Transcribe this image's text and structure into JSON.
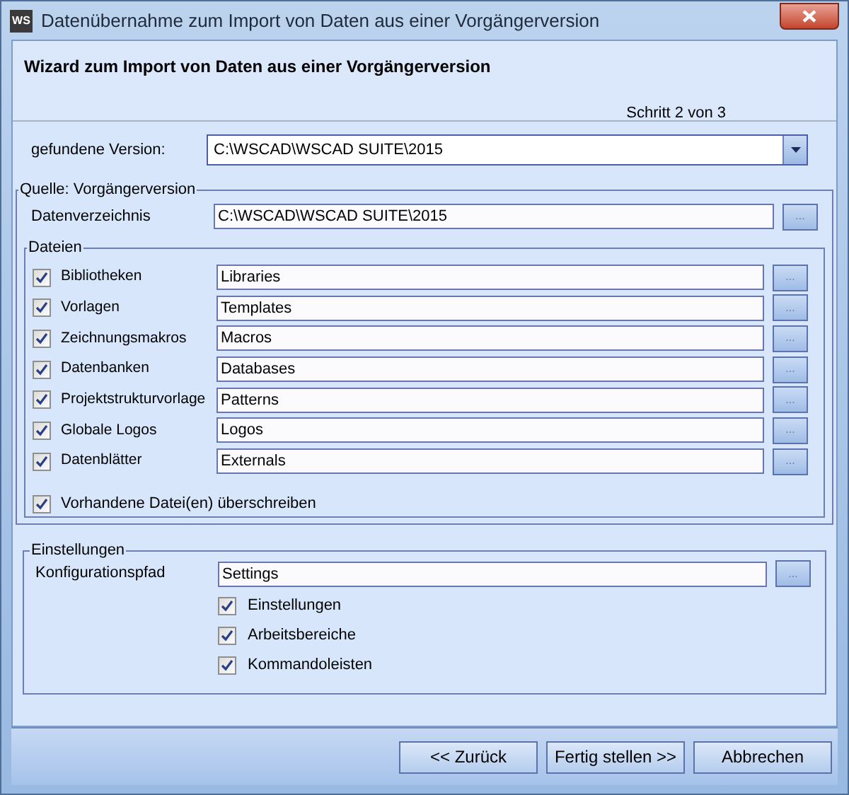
{
  "window": {
    "title": "Datenübernahme zum Import von Daten aus einer Vorgängerversion",
    "app_icon": "WS"
  },
  "header": {
    "title": "Wizard zum Import von Daten aus einer Vorgängerversion",
    "step": "Schritt 2 von 3"
  },
  "version": {
    "label": "gefundene Version:",
    "value": "C:\\WSCAD\\WSCAD SUITE\\2015"
  },
  "source": {
    "legend": "Quelle: Vorgängerversion",
    "directory": {
      "label": "Datenverzeichnis",
      "value": "C:\\WSCAD\\WSCAD SUITE\\2015",
      "browse": "..."
    },
    "files": {
      "legend": "Dateien",
      "items": [
        {
          "label": "Bibliotheken",
          "checked": true,
          "value": "Libraries",
          "browse": "..."
        },
        {
          "label": "Vorlagen",
          "checked": true,
          "value": "Templates",
          "browse": "..."
        },
        {
          "label": "Zeichnungsmakros",
          "checked": true,
          "value": "Macros",
          "browse": "..."
        },
        {
          "label": "Datenbanken",
          "checked": true,
          "value": "Databases",
          "browse": "..."
        },
        {
          "label": "Projektstrukturvorlage",
          "checked": true,
          "value": "Patterns",
          "browse": "..."
        },
        {
          "label": "Globale Logos",
          "checked": true,
          "value": "Logos",
          "browse": "..."
        },
        {
          "label": "Datenblätter",
          "checked": true,
          "value": "Externals",
          "browse": "..."
        }
      ],
      "overwrite": {
        "label": "Vorhandene Datei(en) überschreiben",
        "checked": true
      }
    }
  },
  "settings": {
    "legend": "Einstellungen",
    "path": {
      "label": "Konfigurationspfad",
      "value": "Settings",
      "browse": "..."
    },
    "options": [
      {
        "label": "Einstellungen",
        "checked": true
      },
      {
        "label": "Arbeitsbereiche",
        "checked": true
      },
      {
        "label": "Kommandoleisten",
        "checked": true
      }
    ]
  },
  "buttons": [
    {
      "label": "<< Zurück"
    },
    {
      "label": "Fertig stellen >>"
    },
    {
      "label": "Abbrechen"
    }
  ]
}
